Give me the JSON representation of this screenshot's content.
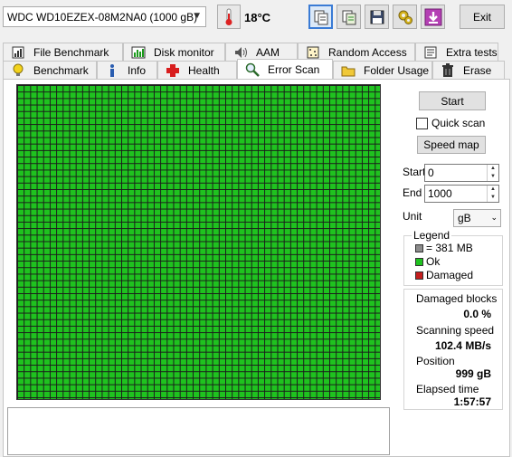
{
  "topbar": {
    "drive": "WDC WD10EZEX-08M2NA0 (1000 gB)",
    "temperature": "18°C",
    "exit_label": "Exit"
  },
  "tabs_row1": [
    {
      "label": "File Benchmark",
      "icon": "file-benchmark-icon"
    },
    {
      "label": "Disk monitor",
      "icon": "disk-monitor-icon"
    },
    {
      "label": "AAM",
      "icon": "speaker-icon"
    },
    {
      "label": "Random Access",
      "icon": "random-access-icon"
    },
    {
      "label": "Extra tests",
      "icon": "extra-tests-icon"
    }
  ],
  "tabs_row2": [
    {
      "label": "Benchmark",
      "icon": "lightbulb-icon"
    },
    {
      "label": "Info",
      "icon": "info-icon"
    },
    {
      "label": "Health",
      "icon": "health-cross-icon"
    },
    {
      "label": "Error Scan",
      "icon": "magnifier-icon",
      "active": true
    },
    {
      "label": "Folder Usage",
      "icon": "folder-icon"
    },
    {
      "label": "Erase",
      "icon": "trash-icon"
    }
  ],
  "controls": {
    "start_label": "Start",
    "quick_scan_label": "Quick scan",
    "quick_scan_checked": false,
    "speed_map_label": "Speed map",
    "start_field_label": "Start",
    "start_value": "0",
    "end_field_label": "End",
    "end_value": "1000",
    "unit_label": "Unit",
    "unit_value": "gB"
  },
  "legend": {
    "title": "Legend",
    "items": [
      {
        "label": "= 381 MB",
        "color": "#8c8c8c"
      },
      {
        "label": "Ok",
        "color": "#1fc21f"
      },
      {
        "label": "Damaged",
        "color": "#c41e1e"
      }
    ]
  },
  "stats": {
    "damaged_label": "Damaged blocks",
    "damaged_value": "0.0 %",
    "speed_label": "Scanning speed",
    "speed_value": "102.4 MB/s",
    "position_label": "Position",
    "position_value": "999 gB",
    "elapsed_label": "Elapsed time",
    "elapsed_value": "1:57:57"
  },
  "scan_grid": {
    "status": "ok",
    "color": "#1fc21f"
  }
}
